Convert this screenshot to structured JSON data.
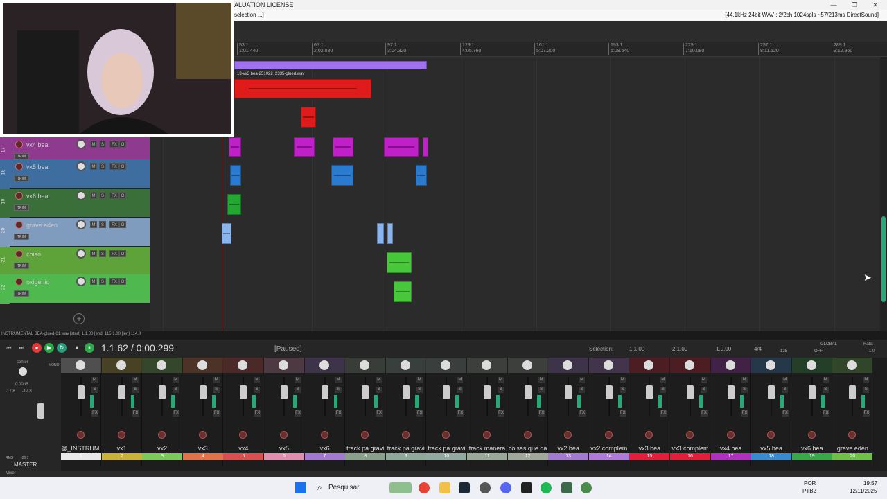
{
  "window": {
    "license": "ALUATION LICENSE",
    "menu_selection": "selection ...]",
    "audio_format": "[44.1kHz 24bit WAV : 2/2ch 1024spls ~57/213ms DirectSound]",
    "minimize": "—",
    "maximize": "❐",
    "close": "✕"
  },
  "timeline": {
    "ticks": [
      {
        "bar": "53.1",
        "time": "1:01.440"
      },
      {
        "bar": "65.1",
        "time": "2:02.880"
      },
      {
        "bar": "97.1",
        "time": "3:04.320"
      },
      {
        "bar": "129.1",
        "time": "4:05.760"
      },
      {
        "bar": "161.1",
        "time": "5:07.200"
      },
      {
        "bar": "193.1",
        "time": "6:08.640"
      },
      {
        "bar": "225.1",
        "time": "7:10.080"
      },
      {
        "bar": "257.1",
        "time": "8:11.520"
      },
      {
        "bar": "289.1",
        "time": "9:12.960"
      }
    ]
  },
  "clip_label": "13-vx3 bea-251022_2335-glued.wav",
  "tracks": [
    {
      "num": "17",
      "name": "vx4 bea",
      "color": "#8e3a8e"
    },
    {
      "num": "18",
      "name": "vx5 bea",
      "color": "#3e6ea0"
    },
    {
      "num": "19",
      "name": "vx6 bea",
      "color": "#3a6f3a"
    },
    {
      "num": "20",
      "name": "grave eden",
      "color": "#7f9cbf"
    },
    {
      "num": "21",
      "name": "coiso",
      "color": "#5ea33a"
    },
    {
      "num": "22",
      "name": "oxigenio",
      "color": "#4fb84f"
    }
  ],
  "track_buttons": {
    "mute": "M",
    "solo": "S",
    "fx": "FX",
    "io": "O",
    "trim": "TRIM"
  },
  "add_track": "+",
  "status_line": "INSTRUMENTAL BEA-glued-01.wav [start] 1.1.00 [end] 115.1.00 [len] 114.0",
  "transport": {
    "position": "1.1.62 / 0:00.299",
    "state": "[Paused]",
    "selection_label": "Selection:",
    "selection_start": "1.1.00",
    "selection_end": "2.1.00",
    "selection_len": "1.0.00",
    "time_sig": "4/4",
    "bpm": "125",
    "global_label": "GLOBAL",
    "global_state": "OFF",
    "rate_label": "Rate:",
    "rate_value": "1.0"
  },
  "master": {
    "label": "MASTER",
    "pan_label": "center",
    "volume": "0.00dB",
    "peak_l": "-17.8",
    "peak_r": "-17.8",
    "rms_label": "RMS",
    "rms_value": "-20.7",
    "mono": "MONO",
    "mixer_tab": "Mixer"
  },
  "mixer_strips": [
    {
      "name": "@_INSTRUMI",
      "num": "1",
      "color": "#e8e8e8"
    },
    {
      "name": "vx1",
      "num": "2",
      "color": "#c8b23a"
    },
    {
      "name": "vx2",
      "num": "3",
      "color": "#7dc85a"
    },
    {
      "name": "vx3",
      "num": "4",
      "color": "#e0734a"
    },
    {
      "name": "vx4",
      "num": "5",
      "color": "#d85050"
    },
    {
      "name": "vx5",
      "num": "6",
      "color": "#e08fb0"
    },
    {
      "name": "vx6",
      "num": "7",
      "color": "#a27ad0"
    },
    {
      "name": "track pa gravi",
      "num": "8",
      "color": "#8aa08a"
    },
    {
      "name": "track pa gravi",
      "num": "9",
      "color": "#8fa89a"
    },
    {
      "name": "track pa gravi",
      "num": "10",
      "color": "#93a8a0"
    },
    {
      "name": "track manera",
      "num": "11",
      "color": "#9aa89a"
    },
    {
      "name": "coisas que da",
      "num": "12",
      "color": "#a0a89a"
    },
    {
      "name": "vx2 bea",
      "num": "13",
      "color": "#a27ad0"
    },
    {
      "name": "vx2 complem",
      "num": "14",
      "color": "#b07ad8"
    },
    {
      "name": "vx3 bea",
      "num": "15",
      "color": "#e0203a"
    },
    {
      "name": "vx3 complem",
      "num": "16",
      "color": "#e0203a"
    },
    {
      "name": "vx4 bea",
      "num": "17",
      "color": "#b030c0"
    },
    {
      "name": "vx5 bea",
      "num": "18",
      "color": "#3a8ad0"
    },
    {
      "name": "vx6 bea",
      "num": "19",
      "color": "#3aa84a"
    },
    {
      "name": "grave eden",
      "num": "20",
      "color": "#6fbf4a"
    }
  ],
  "taskbar": {
    "search": "Pesquisar",
    "lang": "POR",
    "kbd": "PTB2",
    "time": "19:57",
    "date": "12/11/2025"
  }
}
